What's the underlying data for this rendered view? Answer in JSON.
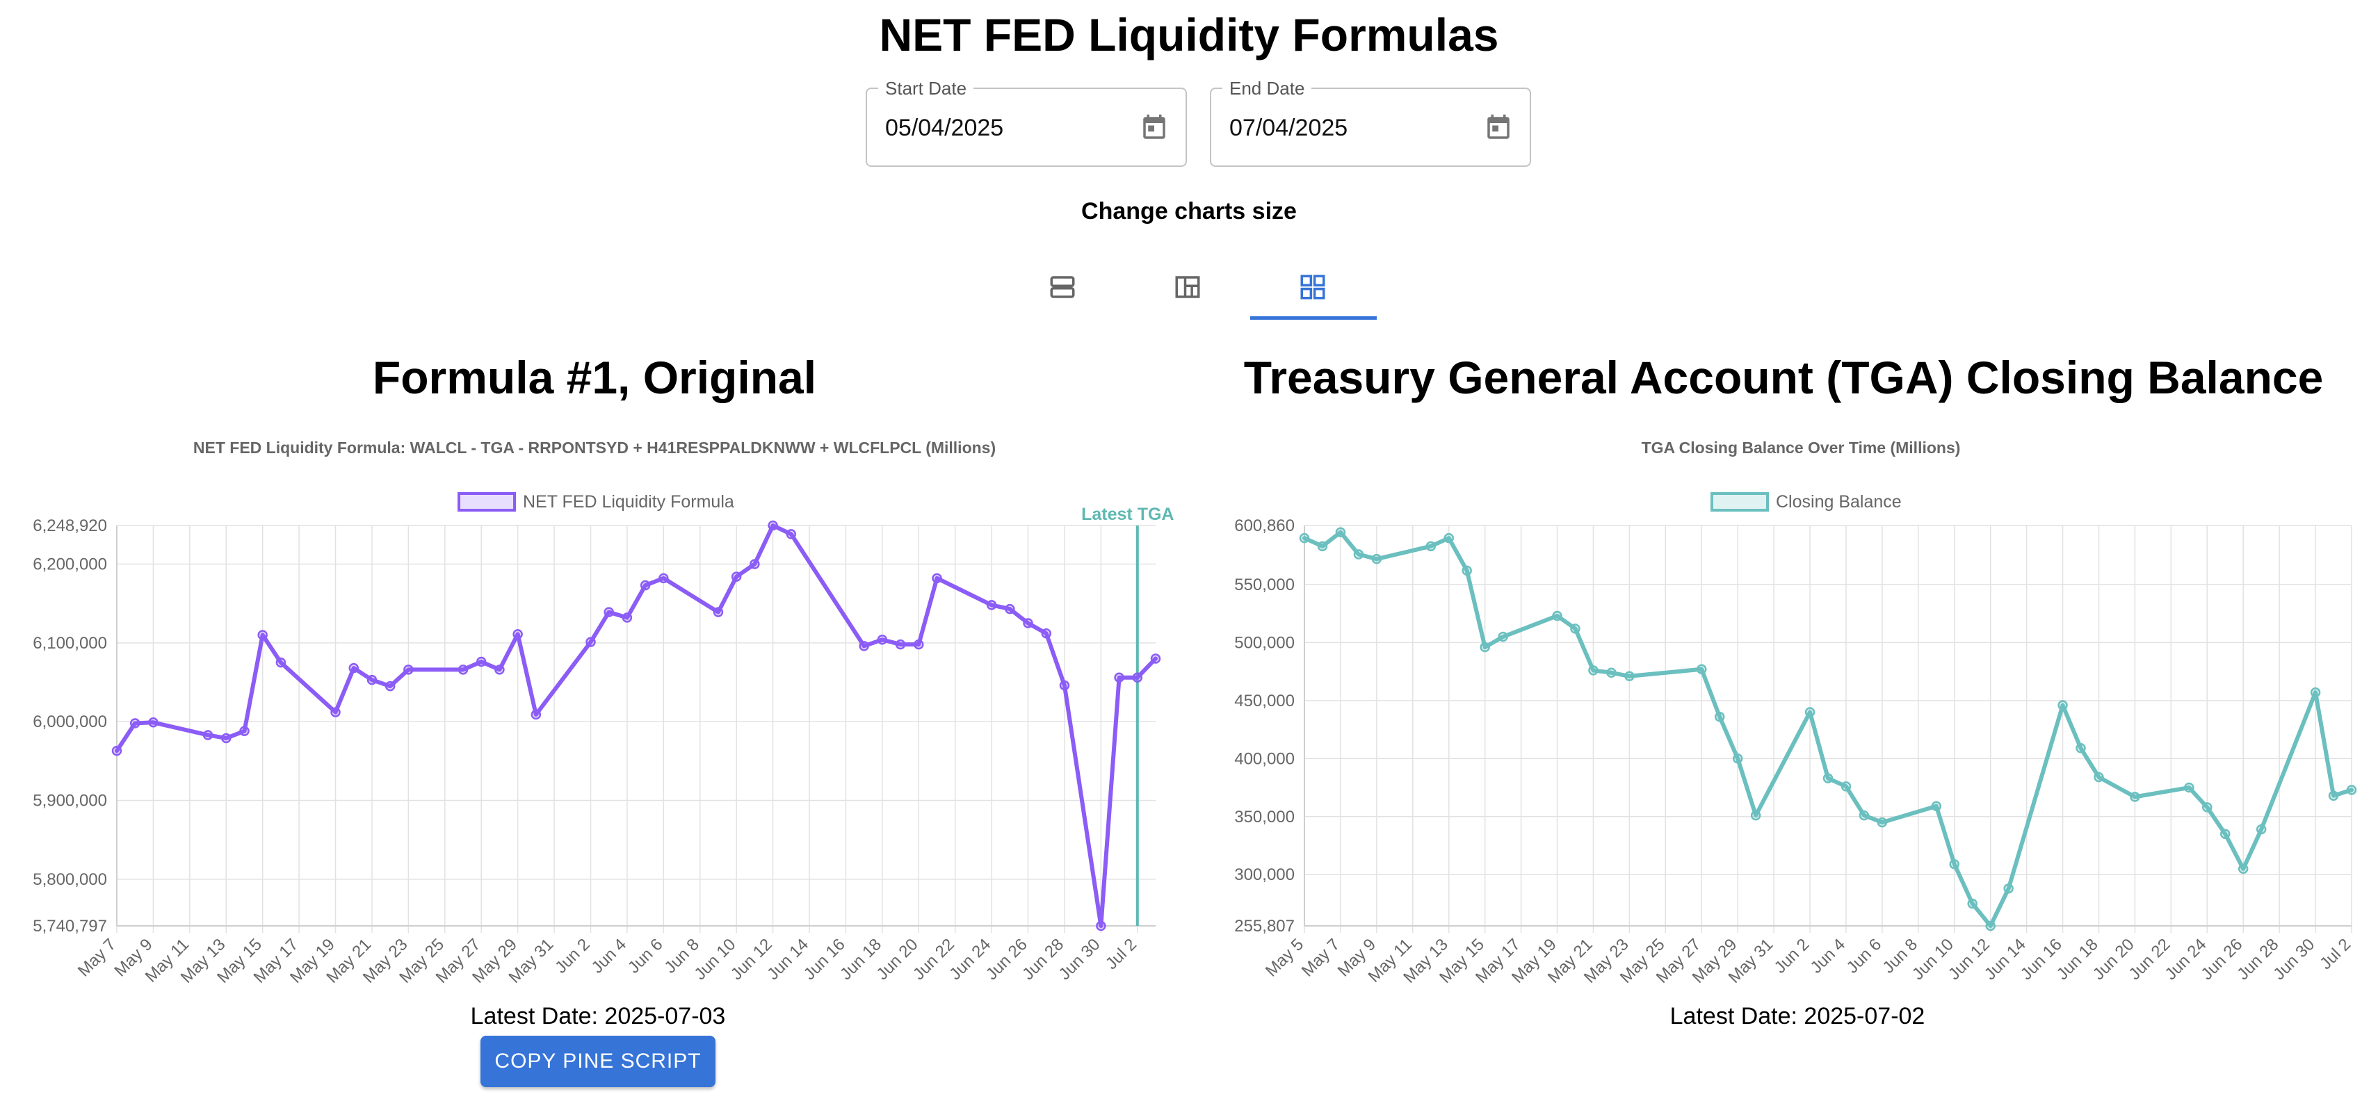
{
  "page": {
    "title": "NET FED Liquidity Formulas"
  },
  "date_range": {
    "start": {
      "label": "Start Date",
      "value": "05/04/2025"
    },
    "end": {
      "label": "End Date",
      "value": "07/04/2025"
    }
  },
  "size_controls": {
    "label": "Change charts size"
  },
  "colors": {
    "accent": "#3674d8",
    "formula_line": "#8b5cf6",
    "tga_line": "#6bbfbf",
    "latest_tga_marker": "#5fb8b2"
  },
  "left_panel": {
    "title": "Formula #1, Original",
    "latest_date": "Latest Date: 2025-07-03",
    "copy_button": "COPY PINE SCRIPT"
  },
  "right_panel": {
    "title": "Treasury General Account (TGA) Closing Balance",
    "latest_date": "Latest Date: 2025-07-02"
  },
  "chart_data": [
    {
      "type": "line",
      "title": "NET FED Liquidity Formula: WALCL - TGA - RRPONTSYD + H41RESPPALDKNWW + WLCFLPCL (Millions)",
      "legend": [
        "NET FED Liquidity Formula"
      ],
      "annotation": {
        "label": "Latest TGA",
        "x": "2025-07-02"
      },
      "x_range": [
        "2025-05-07",
        "2025-07-03"
      ],
      "ylim": [
        5740797,
        6248920
      ],
      "y_ticks": [
        5740797,
        5800000,
        5900000,
        6000000,
        6100000,
        6200000,
        6248920
      ],
      "x_tick_labels": [
        "May 7",
        "May 9",
        "May 11",
        "May 13",
        "May 15",
        "May 17",
        "May 19",
        "May 21",
        "May 23",
        "May 25",
        "May 27",
        "May 29",
        "May 31",
        "Jun 2",
        "Jun 4",
        "Jun 6",
        "Jun 8",
        "Jun 10",
        "Jun 12",
        "Jun 14",
        "Jun 16",
        "Jun 18",
        "Jun 20",
        "Jun 22",
        "Jun 24",
        "Jun 26",
        "Jun 28",
        "Jun 30",
        "Jul 2"
      ],
      "x_ticks": [
        "2025-05-07",
        "2025-05-09",
        "2025-05-11",
        "2025-05-13",
        "2025-05-15",
        "2025-05-17",
        "2025-05-19",
        "2025-05-21",
        "2025-05-23",
        "2025-05-25",
        "2025-05-27",
        "2025-05-29",
        "2025-05-31",
        "2025-06-02",
        "2025-06-04",
        "2025-06-06",
        "2025-06-08",
        "2025-06-10",
        "2025-06-12",
        "2025-06-14",
        "2025-06-16",
        "2025-06-18",
        "2025-06-20",
        "2025-06-22",
        "2025-06-24",
        "2025-06-26",
        "2025-06-28",
        "2025-06-30",
        "2025-07-02"
      ],
      "grid": true,
      "legend_position": "top",
      "series": [
        {
          "name": "NET FED Liquidity Formula",
          "x": [
            "2025-05-07",
            "2025-05-08",
            "2025-05-09",
            "2025-05-12",
            "2025-05-13",
            "2025-05-14",
            "2025-05-15",
            "2025-05-16",
            "2025-05-19",
            "2025-05-20",
            "2025-05-21",
            "2025-05-22",
            "2025-05-23",
            "2025-05-26",
            "2025-05-27",
            "2025-05-28",
            "2025-05-29",
            "2025-05-30",
            "2025-06-02",
            "2025-06-03",
            "2025-06-04",
            "2025-06-05",
            "2025-06-06",
            "2025-06-09",
            "2025-06-10",
            "2025-06-11",
            "2025-06-12",
            "2025-06-13",
            "2025-06-17",
            "2025-06-18",
            "2025-06-19",
            "2025-06-20",
            "2025-06-21",
            "2025-06-24",
            "2025-06-25",
            "2025-06-26",
            "2025-06-27",
            "2025-06-28",
            "2025-06-30",
            "2025-07-01",
            "2025-07-02",
            "2025-07-03"
          ],
          "values": [
            5963000,
            5998000,
            5999000,
            5983000,
            5979000,
            5988000,
            6110000,
            6075000,
            6012000,
            6068000,
            6053000,
            6045000,
            6066000,
            6066000,
            6076000,
            6066000,
            6111000,
            6009000,
            6101000,
            6139000,
            6132000,
            6173000,
            6182000,
            6139000,
            6184000,
            6200000,
            6248920,
            6238000,
            6096000,
            6104000,
            6098000,
            6098000,
            6182000,
            6148000,
            6143000,
            6125000,
            6112000,
            6046000,
            5740797,
            6056000,
            6056000,
            6080000
          ]
        }
      ]
    },
    {
      "type": "line",
      "title": "TGA Closing Balance Over Time (Millions)",
      "legend": [
        "Closing Balance"
      ],
      "x_range": [
        "2025-05-05",
        "2025-07-02"
      ],
      "ylim": [
        255807,
        600860
      ],
      "y_ticks": [
        255807,
        300000,
        350000,
        400000,
        450000,
        500000,
        550000,
        600860
      ],
      "x_tick_labels": [
        "May 5",
        "May 7",
        "May 9",
        "May 11",
        "May 13",
        "May 15",
        "May 17",
        "May 19",
        "May 21",
        "May 23",
        "May 25",
        "May 27",
        "May 29",
        "May 31",
        "Jun 2",
        "Jun 4",
        "Jun 6",
        "Jun 8",
        "Jun 10",
        "Jun 12",
        "Jun 14",
        "Jun 16",
        "Jun 18",
        "Jun 20",
        "Jun 22",
        "Jun 24",
        "Jun 26",
        "Jun 28",
        "Jun 30",
        "Jul 2"
      ],
      "x_ticks": [
        "2025-05-05",
        "2025-05-07",
        "2025-05-09",
        "2025-05-11",
        "2025-05-13",
        "2025-05-15",
        "2025-05-17",
        "2025-05-19",
        "2025-05-21",
        "2025-05-23",
        "2025-05-25",
        "2025-05-27",
        "2025-05-29",
        "2025-05-31",
        "2025-06-02",
        "2025-06-04",
        "2025-06-06",
        "2025-06-08",
        "2025-06-10",
        "2025-06-12",
        "2025-06-14",
        "2025-06-16",
        "2025-06-18",
        "2025-06-20",
        "2025-06-22",
        "2025-06-24",
        "2025-06-26",
        "2025-06-28",
        "2025-06-30",
        "2025-07-02"
      ],
      "grid": true,
      "legend_position": "top",
      "series": [
        {
          "name": "Closing Balance",
          "x": [
            "2025-05-05",
            "2025-05-06",
            "2025-05-07",
            "2025-05-08",
            "2025-05-09",
            "2025-05-12",
            "2025-05-13",
            "2025-05-14",
            "2025-05-15",
            "2025-05-16",
            "2025-05-19",
            "2025-05-20",
            "2025-05-21",
            "2025-05-22",
            "2025-05-23",
            "2025-05-27",
            "2025-05-28",
            "2025-05-29",
            "2025-05-30",
            "2025-06-02",
            "2025-06-03",
            "2025-06-04",
            "2025-06-05",
            "2025-06-06",
            "2025-06-09",
            "2025-06-10",
            "2025-06-11",
            "2025-06-12",
            "2025-06-13",
            "2025-06-16",
            "2025-06-17",
            "2025-06-18",
            "2025-06-20",
            "2025-06-23",
            "2025-06-24",
            "2025-06-25",
            "2025-06-26",
            "2025-06-27",
            "2025-06-30",
            "2025-07-01",
            "2025-07-02"
          ],
          "values": [
            590000,
            583000,
            595000,
            576000,
            572000,
            583000,
            590000,
            562000,
            496000,
            505000,
            523000,
            512000,
            476000,
            474000,
            471000,
            477000,
            436000,
            400000,
            351000,
            440000,
            383000,
            376000,
            351000,
            345000,
            359000,
            309000,
            275000,
            255807,
            288000,
            446000,
            409000,
            384000,
            367000,
            375000,
            358000,
            335000,
            305000,
            339000,
            457000,
            368000,
            373000
          ]
        }
      ]
    }
  ]
}
